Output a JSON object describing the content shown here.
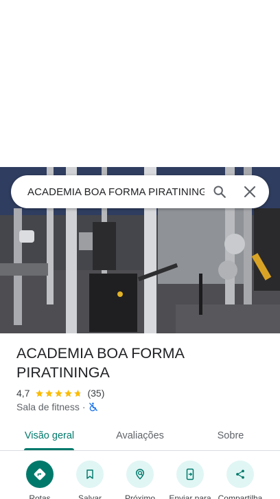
{
  "search": {
    "query": "ACADEMIA BOA FORMA PIRATININGA"
  },
  "place": {
    "title_line1": "ACADEMIA BOA FORMA",
    "title_line2": "PIRATININGA",
    "rating": "4,7",
    "stars": 4.7,
    "review_count": "(35)",
    "category": "Sala de fitness",
    "separator": "·"
  },
  "tabs": [
    {
      "label": "Visão geral",
      "active": true
    },
    {
      "label": "Avaliações",
      "active": false
    },
    {
      "label": "Sobre",
      "active": false
    }
  ],
  "actions": [
    {
      "label": "Rotas",
      "icon": "directions-icon"
    },
    {
      "label": "Salvar",
      "icon": "bookmark-icon"
    },
    {
      "label": "Próximo",
      "icon": "nearby-icon"
    },
    {
      "label": "Enviar para",
      "icon": "send-to-phone-icon"
    },
    {
      "label": "Compartilha",
      "icon": "share-icon"
    }
  ],
  "colors": {
    "accent": "#00796b",
    "star": "#fbbc04",
    "action_bg": "#e0f6f4",
    "wheelchair": "#1a73e8"
  }
}
